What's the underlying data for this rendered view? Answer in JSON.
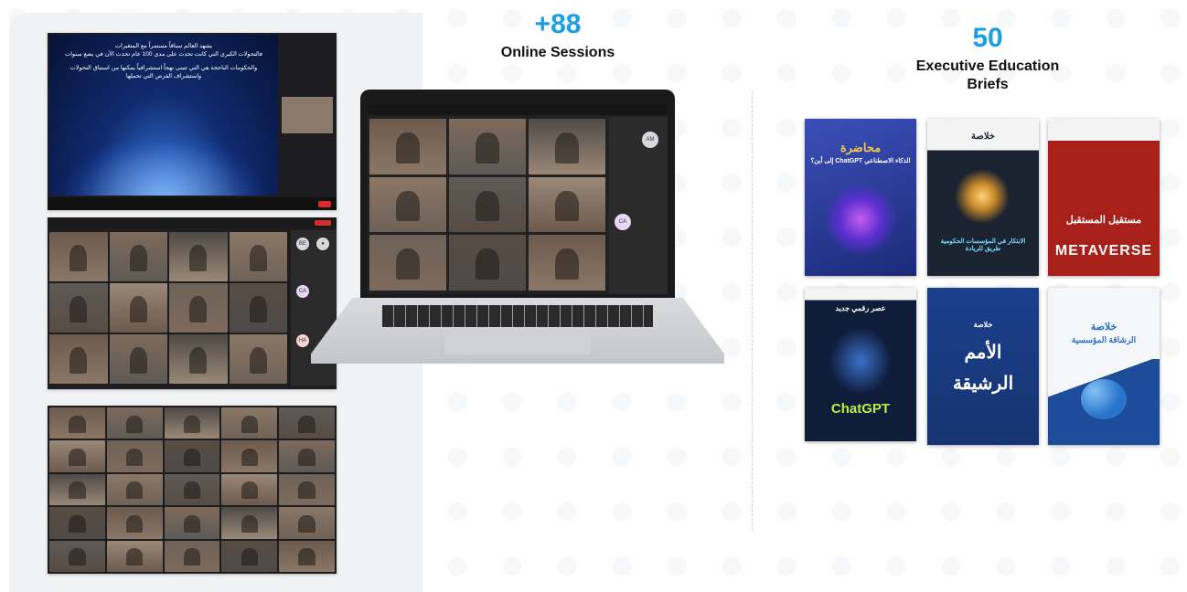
{
  "stats": {
    "sessions": {
      "value": "+88",
      "label": "Online Sessions"
    },
    "briefs": {
      "value": "50",
      "label_line1": "Executive Education",
      "label_line2": "Briefs"
    }
  },
  "slide": {
    "line1": "يشهد العالم سباقاً مستمراً مع المتغيرات",
    "line2": "فالتحولات الكبرى التي كانت تحدث على مدى 100 عام تحدث الآن في بضع سنوات",
    "line3": "والحكومات الناجحة هي التي تتبنى نهجاً استشرافياً يمكنها من استباق التحولات",
    "line4": "واستشراف الفرص التي تحملها"
  },
  "laptop": {
    "avatars": [
      "AM",
      "CA"
    ]
  },
  "gallery2": {
    "avatars": [
      "BE",
      "CA",
      "HA"
    ]
  },
  "books": [
    {
      "title": "محاضرة",
      "subtitle": "الذكاء الاصطناعي ChatGPT إلى أين؟",
      "bg": "#2a3a8c"
    },
    {
      "title": "خلاصة",
      "subtitle": "الابتكار في المؤسسات الحكومية طريق للريادة",
      "bg": "#1b2230"
    },
    {
      "title": "مستقبل المستقبل",
      "subtitle": "METAVERSE",
      "bg": "#a8201a"
    },
    {
      "title": "عصر رقمي جديد",
      "subtitle": "ChatGPT",
      "bg": "#0f1c3a"
    },
    {
      "title": "الأمم الرشيقة",
      "subtitle": "خلاصة",
      "bg": "#1a3f8c"
    },
    {
      "title": "خلاصة",
      "subtitle": "الرشاقة المؤسسية",
      "bg": "#f4f6f9"
    }
  ],
  "colors": {
    "accent": "#1a9fe0",
    "panel": "#f1f2f4"
  }
}
